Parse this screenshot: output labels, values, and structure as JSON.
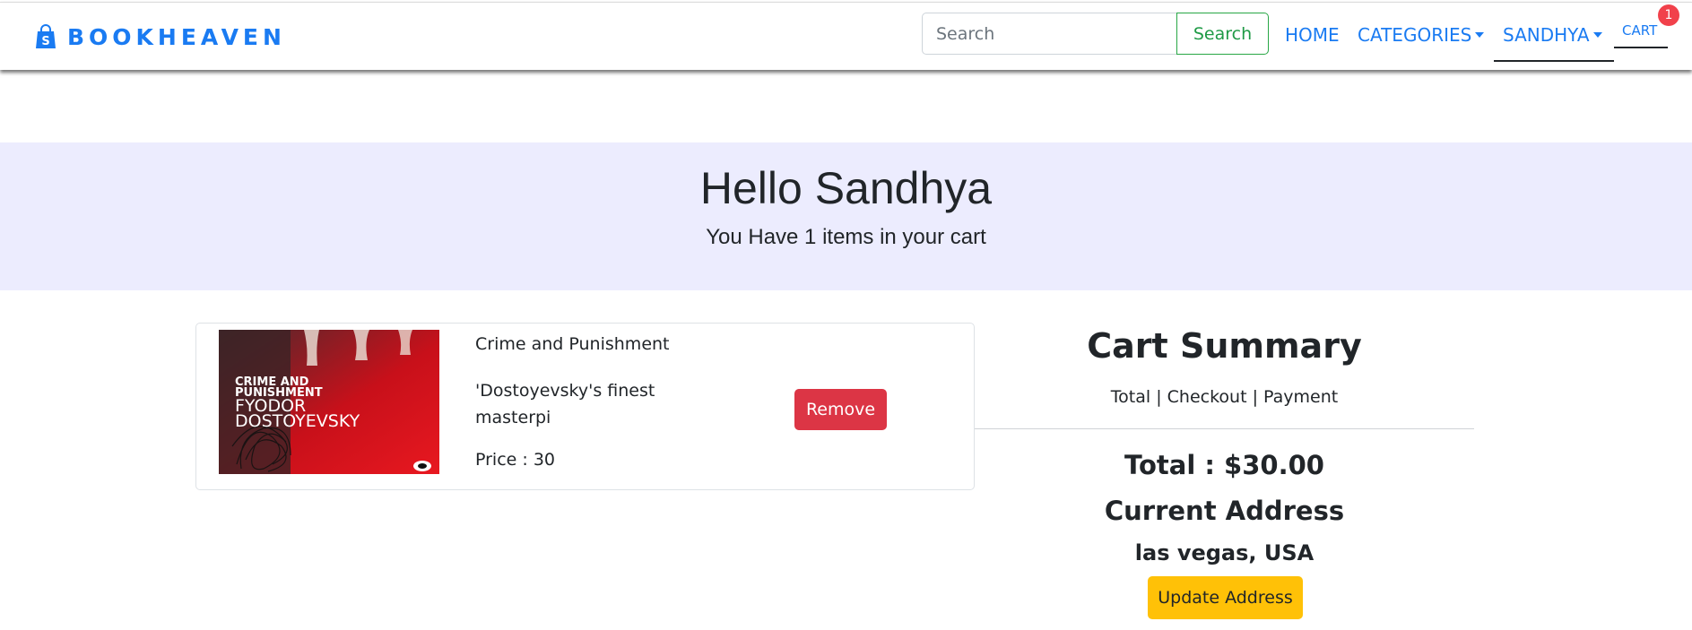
{
  "navbar": {
    "brand": "BOOKHEAVEN",
    "search_placeholder": "Search",
    "search_button": "Search",
    "links": {
      "home": "HOME",
      "categories": "CATEGORIES",
      "user": "SANDHYA",
      "cart": "CART"
    },
    "cart_count": "1"
  },
  "hero": {
    "greeting": "Hello Sandhya",
    "subtitle": "You Have 1 items in your cart"
  },
  "cart": {
    "items": [
      {
        "name": "Crime and Punishment",
        "description": "'Dostoyevsky's finest masterpi",
        "price": "Price : 30",
        "remove_label": "Remove",
        "cover": {
          "title": "CRIME AND PUNISHMENT",
          "author": "FYODOR DOSTOYEVSKY"
        }
      }
    ]
  },
  "summary": {
    "title": "Cart Summary",
    "subtitle": "Total | Checkout | Payment",
    "total": "Total : $30.00",
    "address_label": "Current Address",
    "address": "las vegas, USA",
    "update_button": "Update Address"
  },
  "colors": {
    "brand": "#1a7bf2",
    "hero_bg": "#ececfe",
    "danger": "#dc3545",
    "warning": "#ffc107",
    "success": "#28a745",
    "badge": "#f1414b"
  },
  "icons": {
    "brand": "shopping-bag-icon"
  }
}
